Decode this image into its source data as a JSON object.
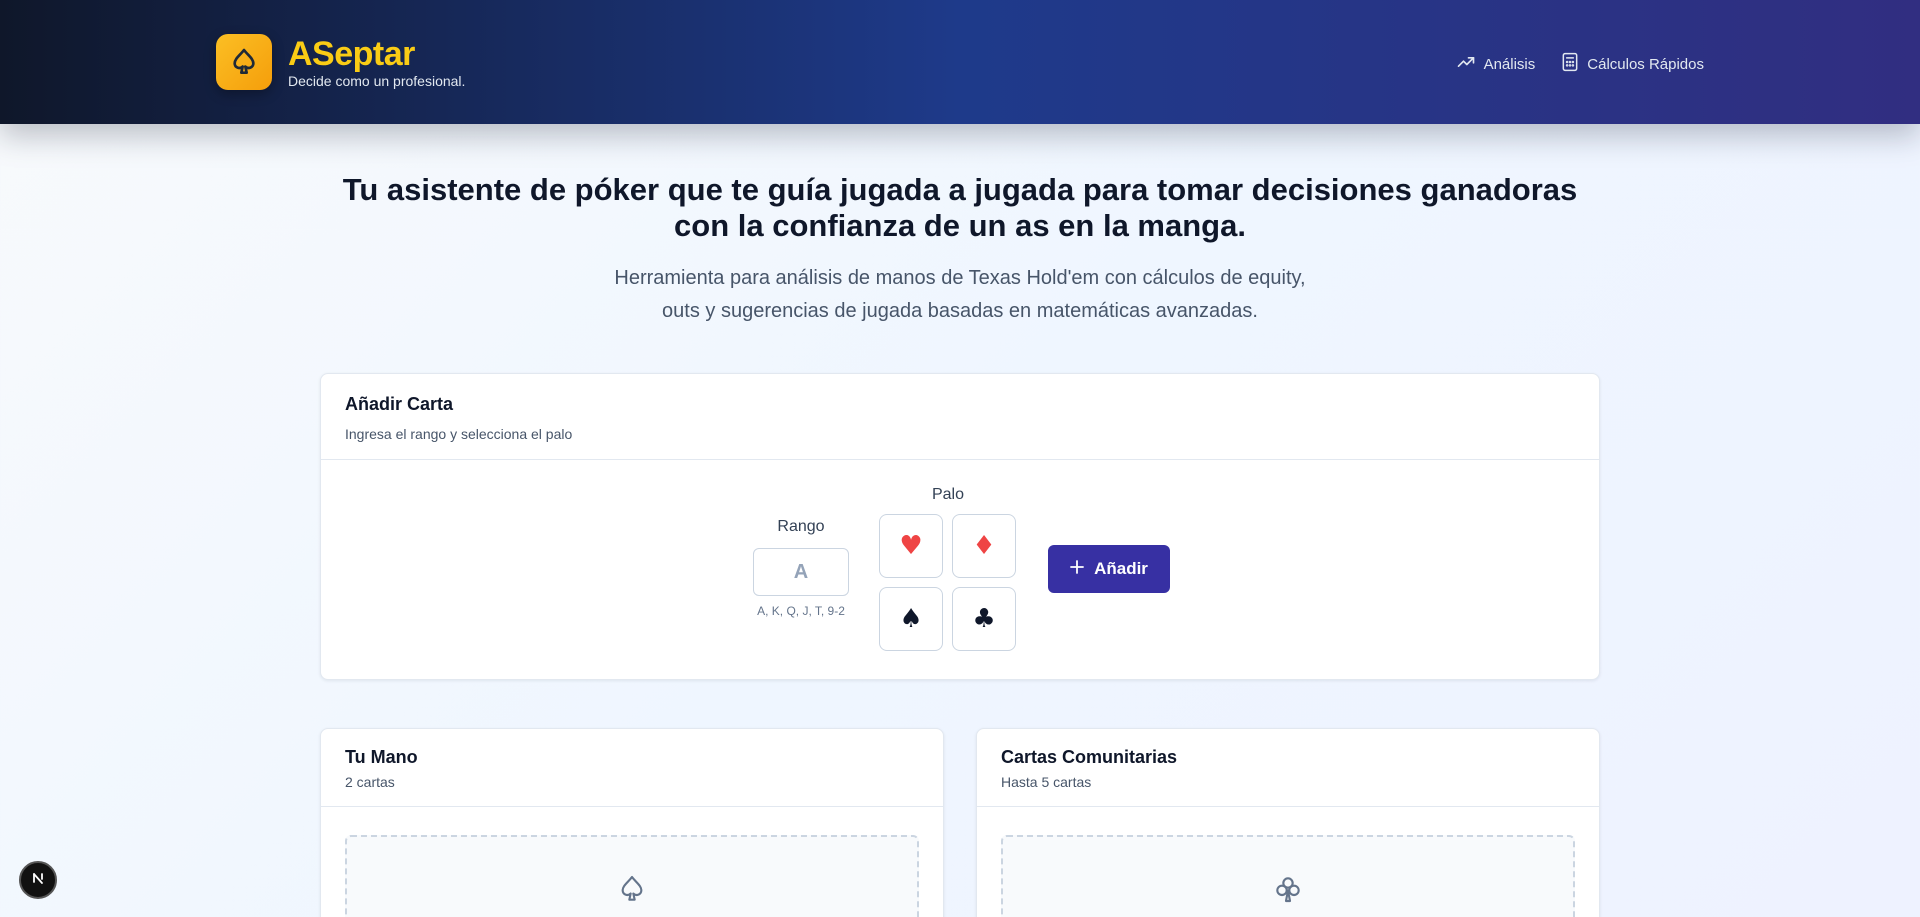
{
  "header": {
    "brand_title": "ASeptar",
    "brand_subtitle": "Decide como un profesional.",
    "logo_icon": "spade-outline-icon",
    "nav": [
      {
        "label": "Análisis",
        "icon": "trending-up-icon"
      },
      {
        "label": "Cálculos Rápidos",
        "icon": "calculator-icon"
      }
    ]
  },
  "hero": {
    "title": "Tu asistente de póker que te guía jugada a jugada para tomar decisiones ganadoras con la confianza de un as en la manga.",
    "subtitle_line1": "Herramienta para análisis de manos de Texas Hold'em con cálculos de equity,",
    "subtitle_line2": "outs y sugerencias de jugada basadas en matemáticas avanzadas."
  },
  "add_card": {
    "title": "Añadir Carta",
    "description": "Ingresa el rango y selecciona el palo",
    "rank_label": "Rango",
    "rank_placeholder": "A",
    "rank_hint": "A, K, Q, J, T, 9-2",
    "suit_label": "Palo",
    "suits": [
      {
        "symbol": "♥",
        "name": "hearts",
        "color": "#ef4444"
      },
      {
        "symbol": "♦",
        "name": "diamonds",
        "color": "#ef4444"
      },
      {
        "symbol": "♠",
        "name": "spades",
        "color": "#0f172a"
      },
      {
        "symbol": "♣",
        "name": "clubs",
        "color": "#0f172a"
      }
    ],
    "add_button": "Añadir"
  },
  "hand": {
    "title": "Tu Mano",
    "count": "2 cartas",
    "empty_icon": "spade-outline-icon"
  },
  "community": {
    "title": "Cartas Comunitarias",
    "count": "Hasta 5 cartas",
    "empty_icon": "club-outline-icon"
  },
  "colors": {
    "accent": "#facc15",
    "primary_button": "#3730a3"
  }
}
